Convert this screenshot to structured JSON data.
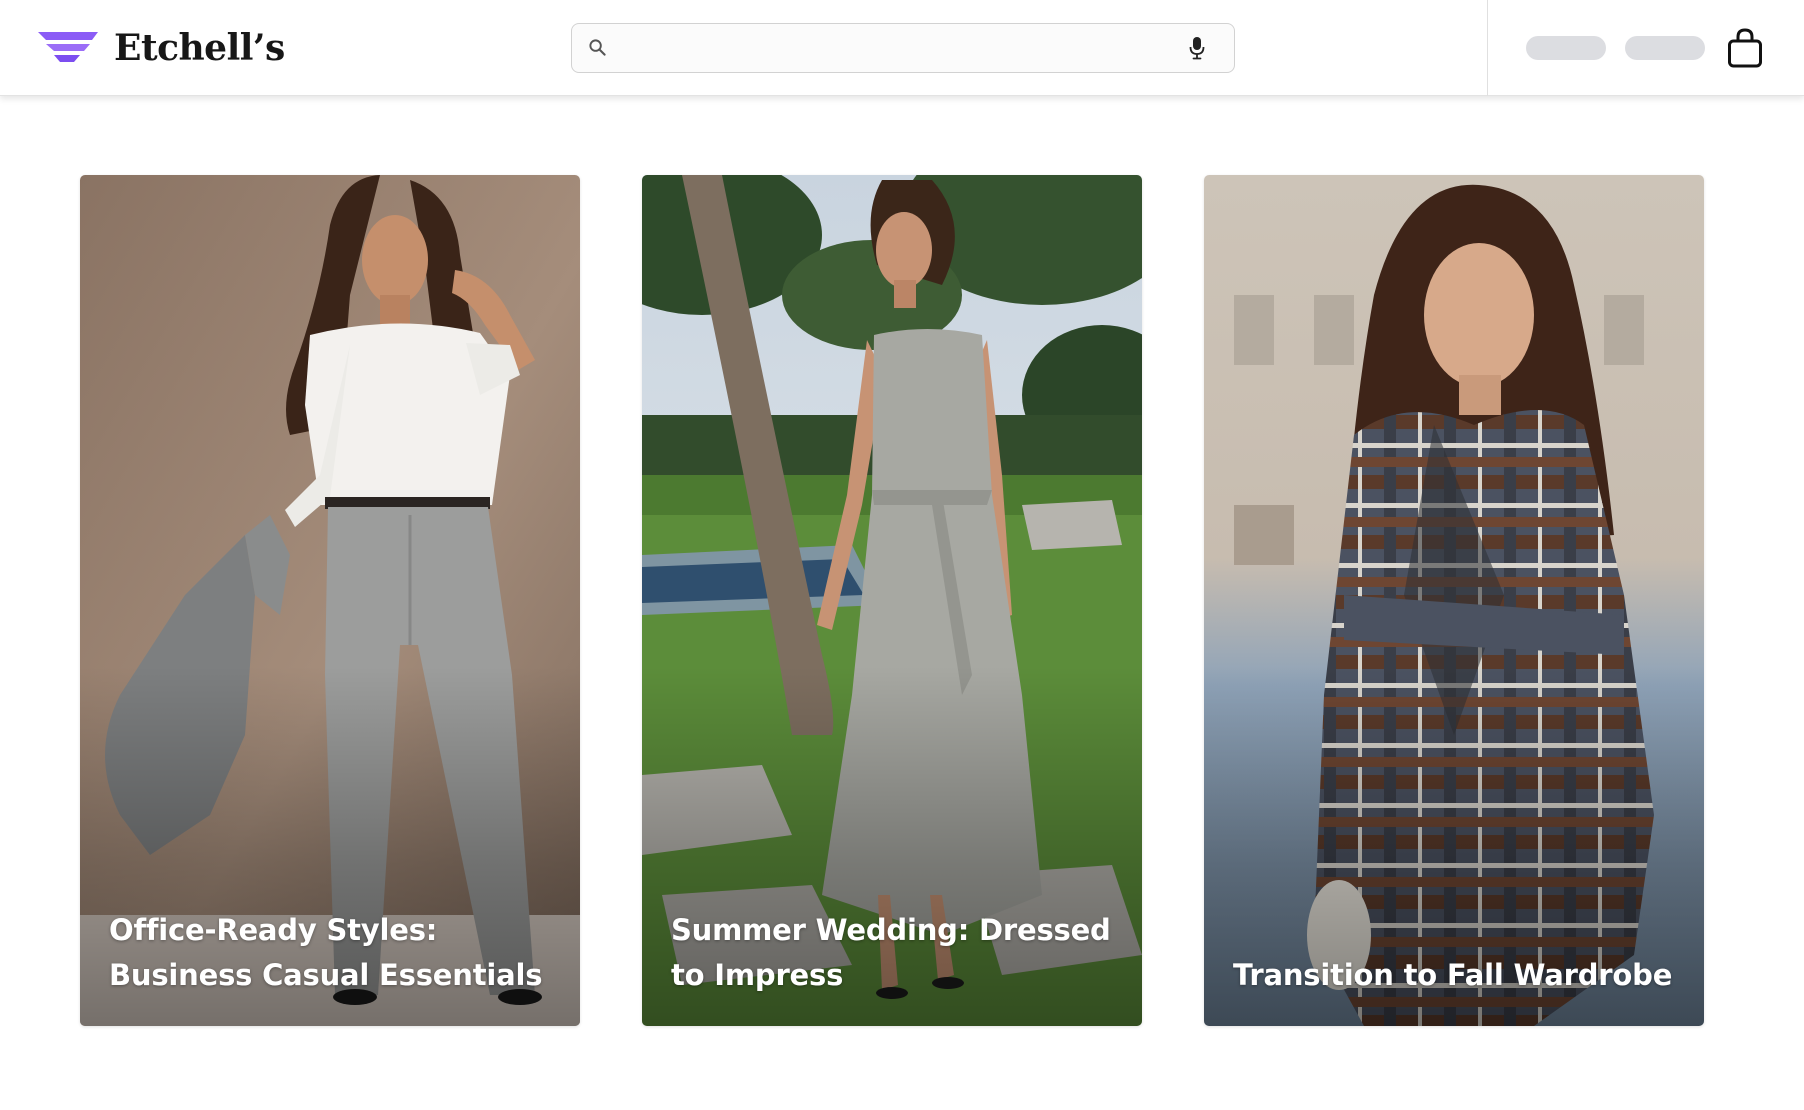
{
  "header": {
    "brand": {
      "name": "Etchell’s",
      "logo_icon": "winged-logo-icon",
      "logo_color": "#8b5cf6"
    },
    "search": {
      "value": "",
      "placeholder": "",
      "search_icon": "search-icon",
      "mic_icon": "microphone-icon"
    },
    "nav_pills": [
      "",
      ""
    ],
    "cart_icon": "shopping-bag-icon"
  },
  "collections": [
    {
      "title": "Office-Ready Styles: Business Casual Essentials",
      "image": "woman in white shirt and grey trousers holding a grey blazer"
    },
    {
      "title": "Summer Wedding: Dressed to Impress",
      "image": "woman in grey slip dress walking on a lawn with palm trees"
    },
    {
      "title": "Transition to Fall Wardrobe",
      "image": "woman in plaid belted wrap coat outdoors"
    }
  ],
  "colors": {
    "accent": "#8b5cf6",
    "text": "#171717",
    "pill": "#dcdde1"
  }
}
